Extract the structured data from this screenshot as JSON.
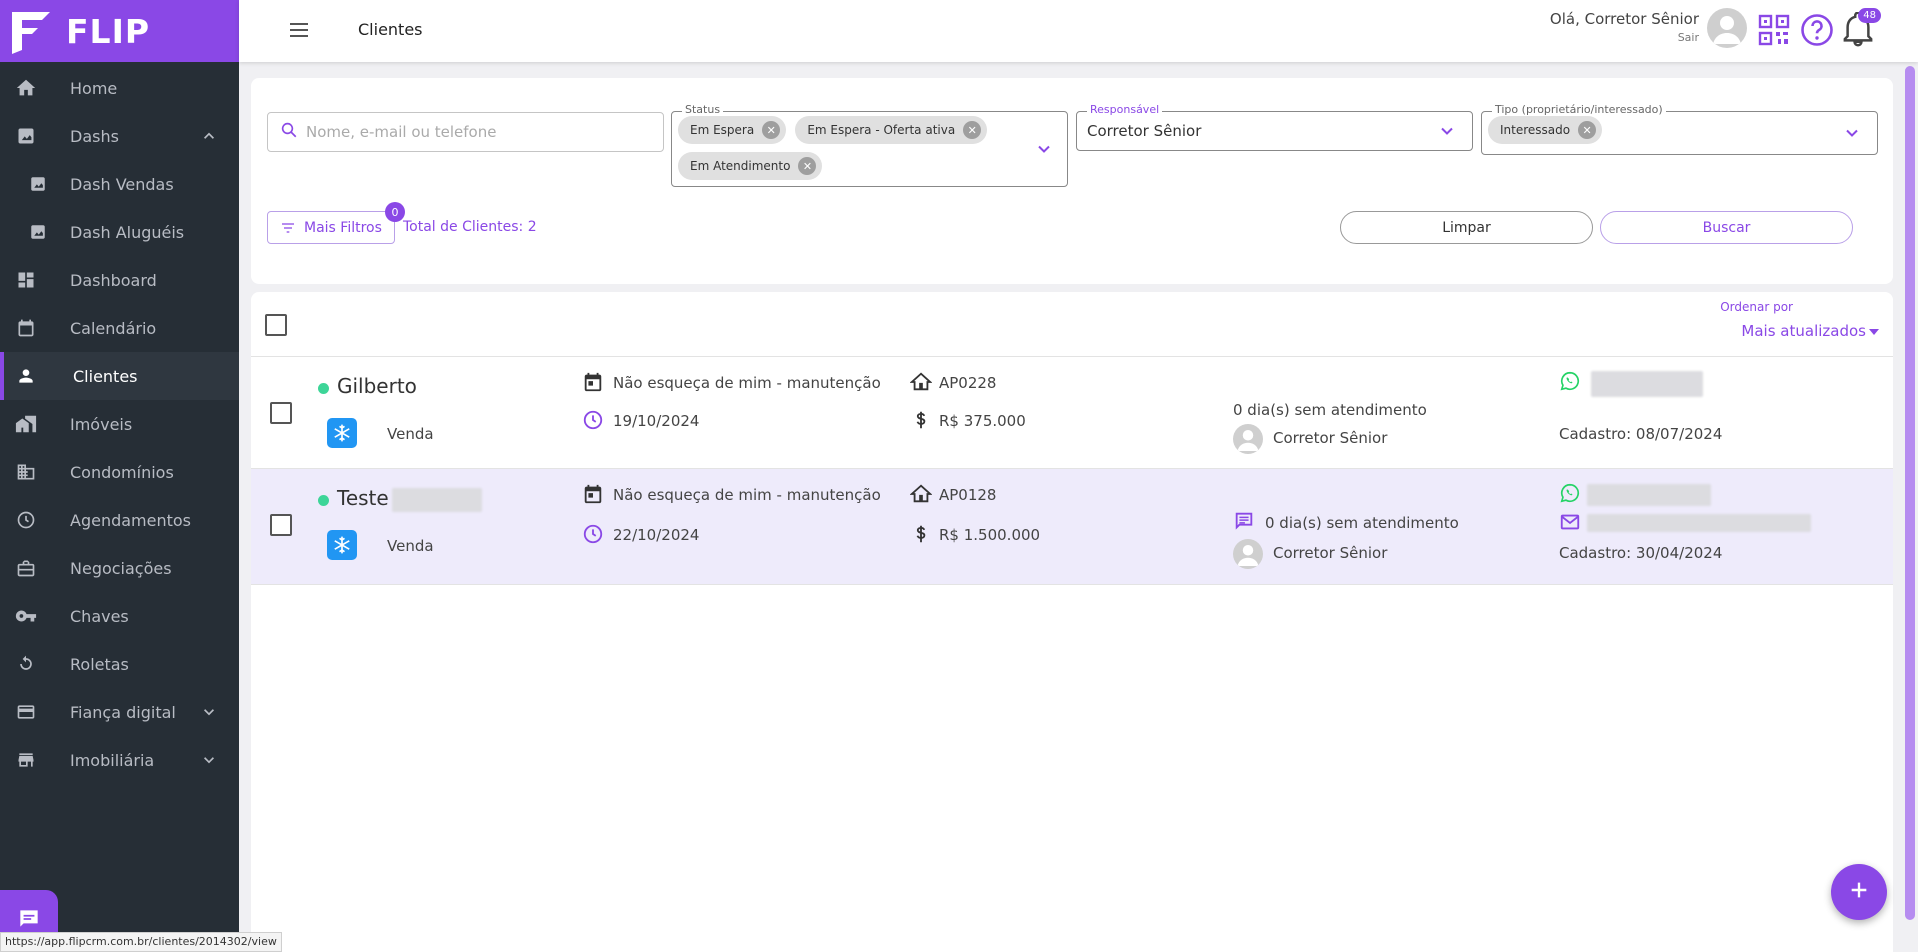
{
  "app": {
    "logo_text": "FLIP",
    "page_title": "Clientes",
    "greeting": "Olá, Corretor Sênior",
    "logout": "Sair",
    "notifications_count": "48",
    "status_url": "https://app.flipcrm.com.br/clientes/2014302/view",
    "accent_color": "#8a48e6"
  },
  "sidebar": {
    "items": [
      {
        "label": "Home",
        "icon": "home-icon"
      },
      {
        "label": "Dashs",
        "icon": "chart-icon"
      },
      {
        "label": "Dash Vendas",
        "icon": "chart-icon"
      },
      {
        "label": "Dash Aluguéis",
        "icon": "chart-icon"
      },
      {
        "label": "Dashboard",
        "icon": "dashboard-icon"
      },
      {
        "label": "Calendário",
        "icon": "calendar-icon"
      },
      {
        "label": "Clientes",
        "icon": "person-icon"
      },
      {
        "label": "Imóveis",
        "icon": "building-icon"
      },
      {
        "label": "Condomínios",
        "icon": "condo-icon"
      },
      {
        "label": "Agendamentos",
        "icon": "clock-icon"
      },
      {
        "label": "Negociações",
        "icon": "briefcase-icon"
      },
      {
        "label": "Chaves",
        "icon": "key-icon"
      },
      {
        "label": "Roletas",
        "icon": "roulette-icon"
      },
      {
        "label": "Fiança digital",
        "icon": "card-icon"
      },
      {
        "label": "Imobiliária",
        "icon": "store-icon"
      }
    ]
  },
  "filters": {
    "search_placeholder": "Nome, e-mail ou telefone",
    "status_legend": "Status",
    "status_chips": [
      "Em Espera",
      "Em Espera - Oferta ativa",
      "Em Atendimento"
    ],
    "responsavel_legend": "Responsável",
    "responsavel_value": "Corretor Sênior",
    "tipo_legend": "Tipo (proprietário/interessado)",
    "tipo_chips": [
      "Interessado"
    ],
    "more_filters": "Mais Filtros",
    "more_filters_count": "0",
    "total": "Total de Clientes: 2",
    "clear_button": "Limpar",
    "search_button": "Buscar"
  },
  "list": {
    "order_label": "Ordenar por",
    "order_value": "Mais atualizados",
    "rows": [
      {
        "name": "Gilberto",
        "type": "Venda",
        "reminder": "Não esqueça de mim - manutenção",
        "date": "19/10/2024",
        "code": "AP0228",
        "price": "R$ 375.000",
        "days": "0 dia(s) sem atendimento",
        "agent": "Corretor Sênior",
        "cadastro": "Cadastro: 08/07/2024"
      },
      {
        "name": "Teste",
        "type": "Venda",
        "reminder": "Não esqueça de mim - manutenção",
        "date": "22/10/2024",
        "code": "AP0128",
        "price": "R$ 1.500.000",
        "days": "0 dia(s) sem atendimento",
        "agent": "Corretor Sênior",
        "cadastro": "Cadastro: 30/04/2024"
      }
    ]
  }
}
